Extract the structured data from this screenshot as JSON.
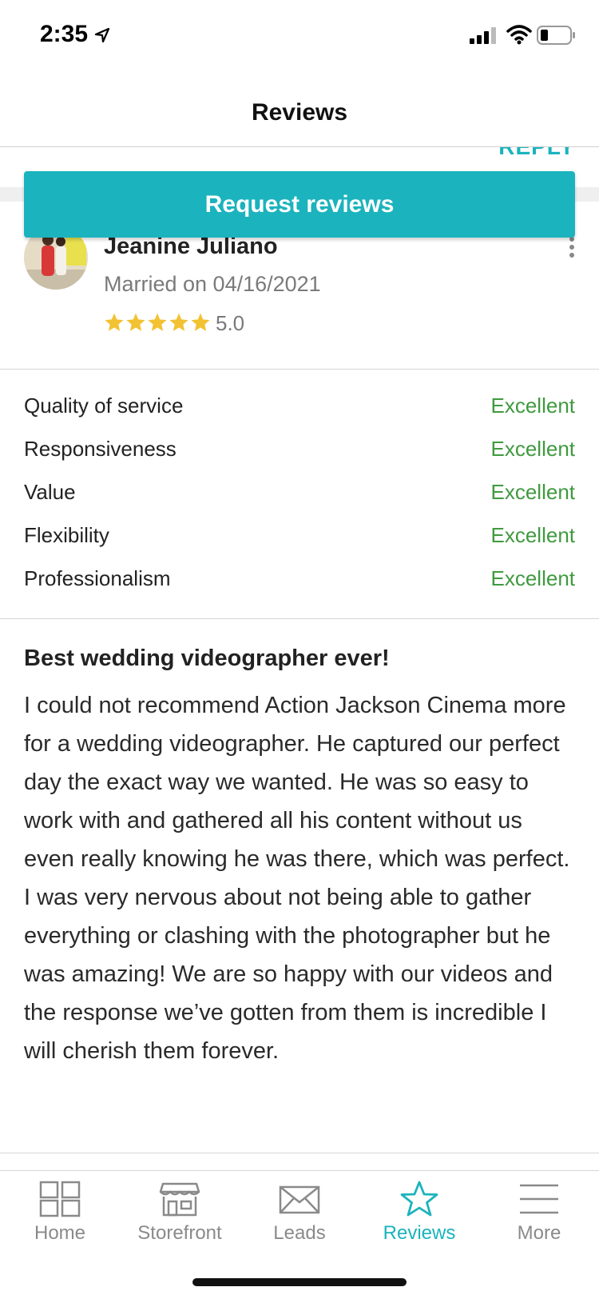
{
  "status_bar": {
    "time": "2:35"
  },
  "header": {
    "title": "Reviews"
  },
  "peek": {
    "reply_label": "REPLY"
  },
  "request_button": {
    "label": "Request reviews"
  },
  "reviewer": {
    "name": "Jeanine Juliano",
    "married": "Married on 04/16/2021",
    "rating": "5.0",
    "stars": 5
  },
  "ratings": [
    {
      "label": "Quality of service",
      "value": "Excellent"
    },
    {
      "label": "Responsiveness",
      "value": "Excellent"
    },
    {
      "label": "Value",
      "value": "Excellent"
    },
    {
      "label": "Flexibility",
      "value": "Excellent"
    },
    {
      "label": "Professionalism",
      "value": "Excellent"
    }
  ],
  "review": {
    "title": "Best wedding videographer ever!",
    "text": "I could not recommend Action Jackson Cinema more for a wedding videographer. He captured our perfect day the exact way we wanted. He was so easy to work with and gathered all his content without us even really knowing he was there, which was perfect. I was very nervous about not being able to gather everything or clashing with the photographer but he was amazing! We are so happy with our videos and the response we’ve gotten from them is incredible I will cherish them forever."
  },
  "tabs": [
    {
      "label": "Home",
      "icon": "home-grid-icon"
    },
    {
      "label": "Storefront",
      "icon": "storefront-icon"
    },
    {
      "label": "Leads",
      "icon": "envelope-icon"
    },
    {
      "label": "Reviews",
      "icon": "star-icon",
      "active": true
    },
    {
      "label": "More",
      "icon": "menu-icon"
    }
  ],
  "colors": {
    "accent": "#1bb3bd",
    "excellent": "#3f9a3f",
    "star": "#f2c233"
  }
}
